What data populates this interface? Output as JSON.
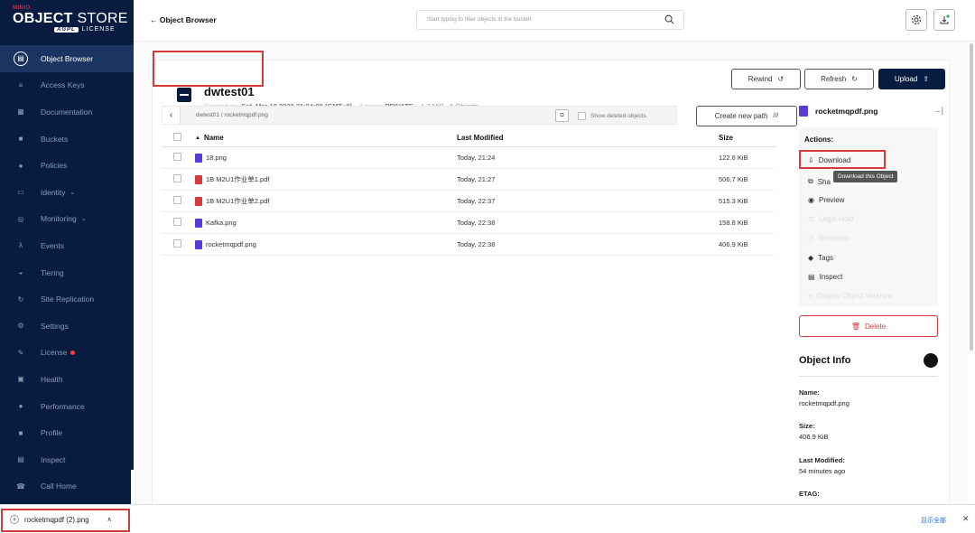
{
  "sidebar": {
    "brand_top": "MINIO",
    "brand_object": "OBJECT",
    "brand_store": " STORE",
    "brand_license_badge": "AGPL",
    "brand_license": "LICENSE",
    "items": [
      {
        "label": "Object Browser",
        "icon": "object-browser-icon",
        "glyph": "▤"
      },
      {
        "label": "Access Keys",
        "icon": "key-icon",
        "glyph": "≡"
      },
      {
        "label": "Documentation",
        "icon": "document-icon",
        "glyph": "▦"
      },
      {
        "label": "Buckets",
        "icon": "bucket-icon",
        "glyph": "■"
      },
      {
        "label": "Policies",
        "icon": "policy-icon",
        "glyph": "●"
      },
      {
        "label": "Identity",
        "icon": "identity-icon",
        "glyph": "▭"
      },
      {
        "label": "Monitoring",
        "icon": "monitoring-icon",
        "glyph": "◎"
      },
      {
        "label": "Events",
        "icon": "lambda-icon",
        "glyph": "λ"
      },
      {
        "label": "Tiering",
        "icon": "tiering-icon",
        "glyph": "◒"
      },
      {
        "label": "Site Replication",
        "icon": "replication-icon",
        "glyph": "↻"
      },
      {
        "label": "Settings",
        "icon": "settings-icon",
        "glyph": "⚙"
      },
      {
        "label": "License",
        "icon": "license-icon",
        "glyph": "✎"
      },
      {
        "label": "Health",
        "icon": "health-icon",
        "glyph": "▣"
      },
      {
        "label": "Performance",
        "icon": "performance-icon",
        "glyph": "●"
      },
      {
        "label": "Profile",
        "icon": "profile-icon",
        "glyph": "■"
      },
      {
        "label": "Inspect",
        "icon": "inspect-icon",
        "glyph": "▤"
      },
      {
        "label": "Call Home",
        "icon": "call-home-icon",
        "glyph": "☎"
      }
    ]
  },
  "topbar": {
    "back_label": "← Object Browser",
    "search_placeholder": "Start typing to filter objects in the bucket"
  },
  "bucket": {
    "name": "dwtest01",
    "created_label": "Created on:",
    "created_value": "Sat, Mar 18 2023 21:24:09 (GMT+8)",
    "access_label": "Access:",
    "access_value": "PRIVATE",
    "usage": "1.7 MiB - 5 Objects"
  },
  "toolbar": {
    "rewind": "Rewind",
    "refresh": "Refresh",
    "upload": "Upload"
  },
  "browser": {
    "path": "dwtest01 / rocketmqpdf.png",
    "show_deleted": "Show deleted objects",
    "create_path": "Create new path",
    "columns": {
      "name": "Name",
      "modified": "Last Modified",
      "size": "Size"
    },
    "rows": [
      {
        "name": "18.png",
        "modified": "Today, 21:24",
        "size": "122.6 KiB",
        "type": "image"
      },
      {
        "name": "1B M2U1作业单1.pdf",
        "modified": "Today, 21:27",
        "size": "506.7 KiB",
        "type": "pdf"
      },
      {
        "name": "1B M2U1作业单2.pdf",
        "modified": "Today, 22:37",
        "size": "515.3 KiB",
        "type": "pdf"
      },
      {
        "name": "Kafka.png",
        "modified": "Today, 22:38",
        "size": "158.8 KiB",
        "type": "image"
      },
      {
        "name": "rocketmqpdf.png",
        "modified": "Today, 22:38",
        "size": "406.9 KiB",
        "type": "image"
      }
    ]
  },
  "details": {
    "filename": "rocketmqpdf.png",
    "actions_label": "Actions:",
    "download": "Download",
    "share": "Sha",
    "tooltip": "Download this Object",
    "preview": "Preview",
    "legal_hold": "Legal Hold",
    "retention": "Retention",
    "tags": "Tags",
    "inspect": "Inspect",
    "display_versions": "Display Object Versions",
    "delete": "Delete",
    "object_info": "Object Info",
    "name_label": "Name:",
    "name_value": "rocketmqpdf.png",
    "size_label": "Size:",
    "size_value": "406.9 KiB",
    "modified_label": "Last Modified:",
    "modified_value": "54 minutes ago",
    "etag_label": "ETAG:"
  },
  "downloads": {
    "file": "rocketmqpdf (2).png",
    "show_all": "显示全部"
  },
  "colors": {
    "sidebar_bg": "#081c42",
    "accent_red": "#d63b3b",
    "pdf_red": "#d63b3b",
    "image_purple": "#5b3bd6"
  }
}
